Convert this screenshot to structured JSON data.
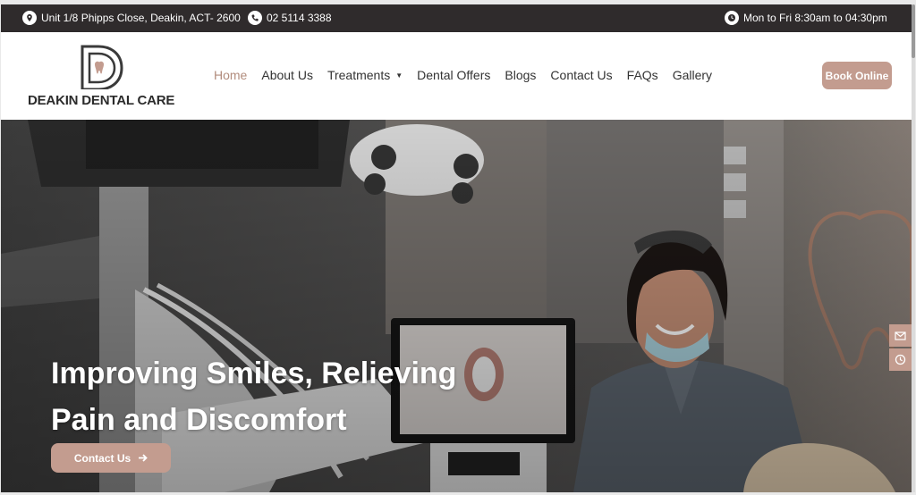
{
  "topbar": {
    "address": "Unit 1/8 Phipps Close, Deakin, ACT- 2600",
    "phone": "02 5114 3388",
    "hours": "Mon to Fri 8:30am to 04:30pm",
    "icons": [
      "location-icon",
      "phone-icon",
      "clock-icon"
    ]
  },
  "logo": {
    "name": "DEAKIN DENTAL CARE"
  },
  "nav": {
    "items": [
      {
        "label": "Home",
        "active": true
      },
      {
        "label": "About Us"
      },
      {
        "label": "Treatments",
        "has_dropdown": true
      },
      {
        "label": "Dental Offers"
      },
      {
        "label": "Blogs"
      },
      {
        "label": "Contact Us"
      },
      {
        "label": "FAQs"
      },
      {
        "label": "Gallery"
      }
    ],
    "book_label": "Book Online"
  },
  "hero": {
    "title_line1": "Improving Smiles, Relieving",
    "title_line2": "Pain and Discomfort",
    "cta_label": "Contact Us",
    "side_tabs": [
      "mail-icon",
      "clock-icon"
    ]
  },
  "colors": {
    "accent": "#c39c8f",
    "topbar_bg": "#2f2b2c",
    "nav_active": "#b28c7d"
  }
}
